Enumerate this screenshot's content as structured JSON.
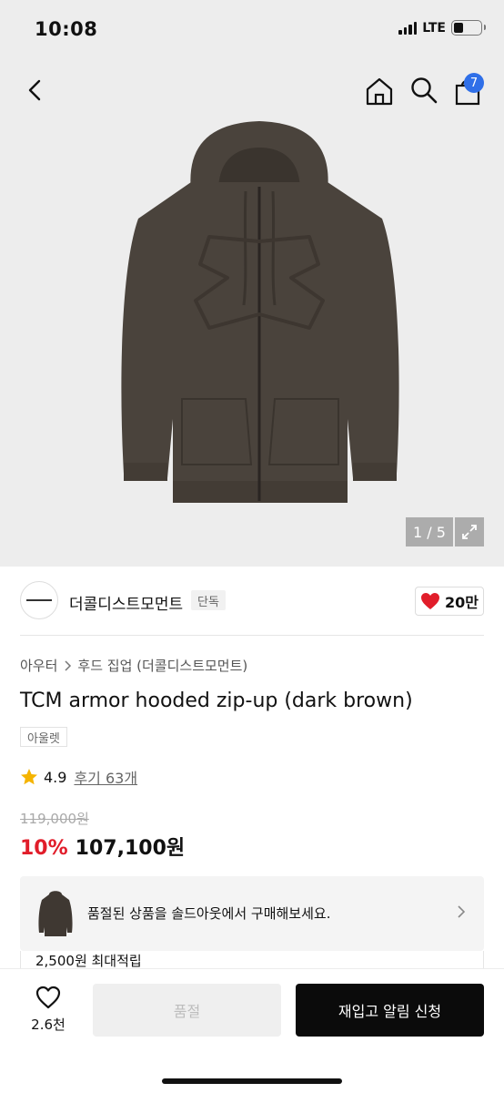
{
  "status_bar": {
    "time": "10:08",
    "network": "LTE",
    "battery_level": 0.35
  },
  "nav": {
    "cart_count": "7",
    "icons": [
      "back-arrow-icon",
      "home-icon",
      "search-icon",
      "shopping-bag-icon"
    ]
  },
  "gallery": {
    "counter": "1 / 5"
  },
  "brand": {
    "name": "더콜디스트모먼트",
    "tag": "단독",
    "likes": "20만"
  },
  "product": {
    "breadcrumb_main": "아우터",
    "breadcrumb_sub": "후드 집업 (더콜디스트모먼트)",
    "title": "TCM armor hooded zip-up (dark brown)",
    "outlet_tag": "아울렛",
    "rating": "4.9",
    "review_label": "후기 63개",
    "original_price": "119,000원",
    "discount": "10%",
    "price": "107,100원"
  },
  "soldout_card": {
    "message": "품절된 상품을 솔드아웃에서 구매해보세요."
  },
  "points": {
    "label": "2,500원 최대적립"
  },
  "bottom_bar": {
    "wish_count": "2.6천",
    "soldout_label": "품절",
    "restock_label": "재입고 알림 신청"
  },
  "colors": {
    "accent_red": "#e11d2a",
    "badge_blue": "#2f6fe8",
    "hoodie": "#4a433c"
  }
}
